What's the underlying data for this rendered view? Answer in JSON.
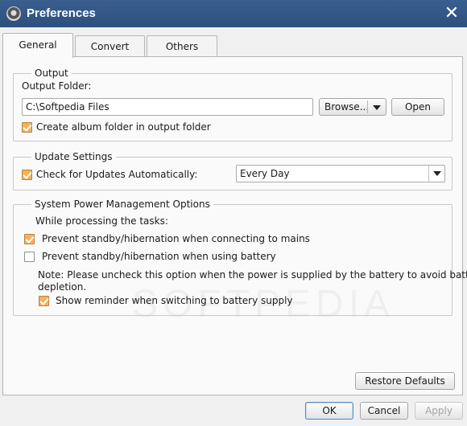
{
  "window": {
    "title": "Preferences"
  },
  "tabs": [
    {
      "label": "General",
      "active": true
    },
    {
      "label": "Convert",
      "active": false
    },
    {
      "label": "Others",
      "active": false
    }
  ],
  "output": {
    "legend": "Output",
    "folder_label": "Output Folder:",
    "folder_value": "C:\\Softpedia Files",
    "browse_label": "Browse...",
    "open_label": "Open",
    "create_album_label": "Create album folder in output folder",
    "create_album_checked": true
  },
  "update": {
    "legend": "Update Settings",
    "check_label": "Check for Updates Automatically:",
    "check_checked": true,
    "frequency_value": "Every Day"
  },
  "power": {
    "legend": "System Power Management Options",
    "while_label": "While processing the tasks:",
    "prevent_mains_label": "Prevent standby/hibernation when connecting to mains",
    "prevent_mains_checked": true,
    "prevent_battery_label": "Prevent standby/hibernation when using battery",
    "prevent_battery_checked": false,
    "note_line1": "Note: Please uncheck this option when the power is supplied by the battery to avoid battery",
    "note_line2": "depletion.",
    "reminder_label": "Show reminder when switching to battery supply",
    "reminder_checked": true
  },
  "footer": {
    "restore_label": "Restore Defaults",
    "ok_label": "OK",
    "cancel_label": "Cancel",
    "apply_label": "Apply",
    "apply_enabled": false
  },
  "watermark": "SOFTPEDIA",
  "icons": {
    "app": "speaker-icon",
    "close": "close-icon",
    "dropdown": "chevron-down-icon",
    "check": "checkmark-icon"
  },
  "colors": {
    "titlebar": "#2d4f7e",
    "checkbox_checked": "#f7b15a",
    "primary_border": "#5b8ac2"
  }
}
